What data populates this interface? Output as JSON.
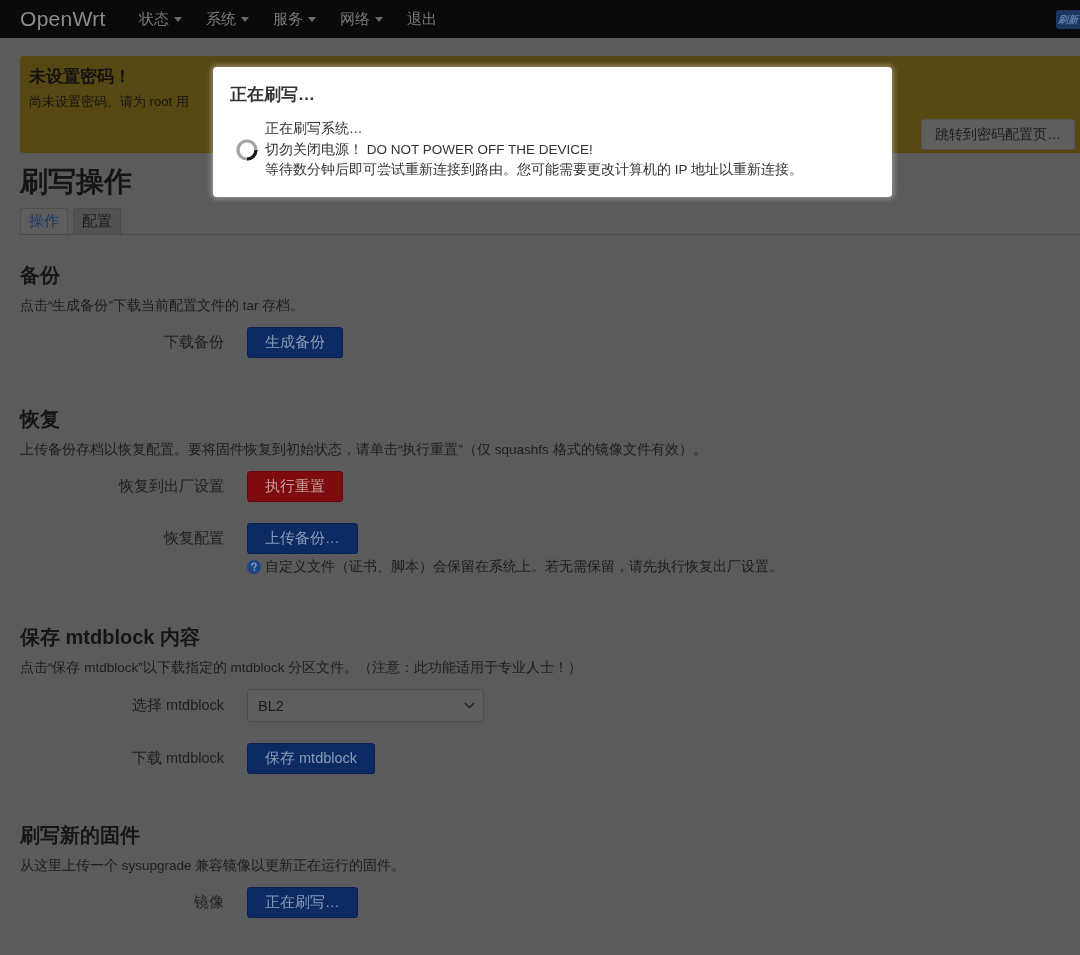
{
  "navbar": {
    "brand": "OpenWrt",
    "menu": [
      {
        "label": "状态",
        "dropdown": true
      },
      {
        "label": "系统",
        "dropdown": true
      },
      {
        "label": "服务",
        "dropdown": true
      },
      {
        "label": "网络",
        "dropdown": true
      },
      {
        "label": "退出",
        "dropdown": false
      }
    ],
    "badge": "刷新"
  },
  "alert": {
    "title": "未设置密码！",
    "text": "尚未设置密码。请为 root 用",
    "button": "跳转到密码配置页…"
  },
  "page": {
    "title": "刷写操作",
    "tabs": [
      {
        "label": "操作",
        "selected": true
      },
      {
        "label": "配置",
        "selected": false
      }
    ]
  },
  "sections": [
    {
      "heading": "备份",
      "description": "点击“生成备份”下载当前配置文件的 tar 存档。",
      "rows": [
        {
          "kind": "button",
          "label": "下载备份",
          "button": "生成备份"
        }
      ]
    },
    {
      "heading": "恢复",
      "description": "上传备份存档以恢复配置。要将固件恢复到初始状态，请单击“执行重置”（仅 squashfs 格式的镜像文件有效）。",
      "rows": [
        {
          "kind": "reset",
          "label": "恢复到出厂设置",
          "button": "执行重置"
        },
        {
          "kind": "button",
          "label": "恢复配置",
          "button": "上传备份…",
          "help": "自定义文件（证书、脚本）会保留在系统上。若无需保留，请先执行恢复出厂设置。"
        }
      ]
    },
    {
      "heading": "保存 mtdblock 内容",
      "description": "点击“保存 mtdblock”以下载指定的 mtdblock 分区文件。（注意：此功能适用于专业人士！）",
      "rows": [
        {
          "kind": "select",
          "label": "选择 mtdblock",
          "value": "BL2"
        },
        {
          "kind": "button",
          "label": "下载 mtdblock",
          "button": "保存 mtdblock"
        }
      ]
    },
    {
      "heading": "刷写新的固件",
      "description": "从这里上传一个 sysupgrade 兼容镜像以更新正在运行的固件。",
      "rows": [
        {
          "kind": "button",
          "label": "镜像",
          "button": "正在刷写…"
        }
      ]
    }
  ],
  "modal": {
    "title": "正在刷写…",
    "lines": [
      "正在刷写系统…",
      "切勿关闭电源！ DO NOT POWER OFF THE DEVICE!",
      "等待数分钟后即可尝试重新连接到路由。您可能需要更改计算机的 IP 地址以重新连接。"
    ]
  }
}
